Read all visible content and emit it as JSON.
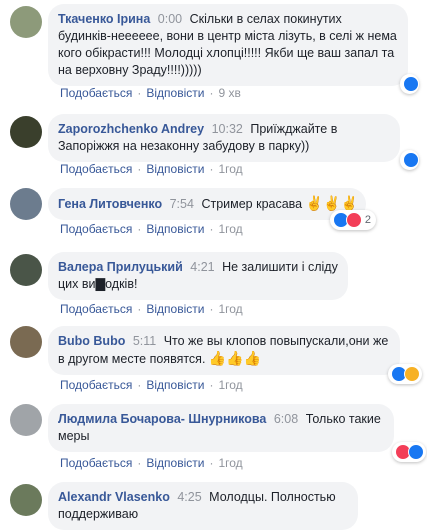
{
  "comments": [
    {
      "author": "Ткаченко Ірина",
      "time": "0:00",
      "text": "Скільки в селах покинутих будинків-нееееее, вони в центр міста лізуть, в селі ж нема кого обікрасти!!! Молодці хлопці!!!!! Якби ще ваш запал та на верховну Зраду!!!!)))))",
      "like": "Подобається",
      "reply": "Відповісти",
      "age": "9 хв",
      "reactions": [
        "like"
      ],
      "reaction_count": ""
    },
    {
      "author": "Zaporozhchenko Andrey",
      "time": "10:32",
      "text": "Приїжджайте в Запоріжжя на незаконну забудову в парку))",
      "like": "Подобається",
      "reply": "Відповісти",
      "age": "1год",
      "reactions": [
        "like"
      ],
      "reaction_count": ""
    },
    {
      "author": "Гена Литовченко",
      "time": "7:54",
      "text": "Стример красава",
      "emoji": "✌️✌️✌️",
      "like": "Подобається",
      "reply": "Відповісти",
      "age": "1год",
      "reactions": [
        "like",
        "love"
      ],
      "reaction_count": "2"
    },
    {
      "author": "Валера Прилуцький",
      "time": "4:21",
      "text": "Не залишити і сліду цих ви▇одків!",
      "like": "Подобається",
      "reply": "Відповісти",
      "age": "1год",
      "reactions": [],
      "reaction_count": ""
    },
    {
      "author": "Bubo Bubo",
      "time": "5:11",
      "text": "Что же вы клопов повыпускали,они же в другом месте появятся.",
      "emoji": "👍👍👍",
      "like": "Подобається",
      "reply": "Відповісти",
      "age": "1год",
      "reactions": [
        "like",
        "sad"
      ],
      "reaction_count": ""
    },
    {
      "author": "Людмила Бочарова- Шнурникова",
      "time": "6:08",
      "text": "Только такие меры",
      "like": "Подобається",
      "reply": "Відповісти",
      "age": "1год",
      "reactions": [
        "love",
        "like"
      ],
      "reaction_count": ""
    },
    {
      "author": "Alexandr Vlasenko",
      "time": "4:25",
      "text": "Молодцы. Полностью поддерживаю",
      "like": "",
      "reply": "",
      "age": "",
      "reactions": [],
      "reaction_count": ""
    }
  ],
  "colors": {
    "link": "#385898",
    "bubble": "#f2f3f5",
    "like": "#1877f2",
    "love": "#f33e58",
    "sad": "#f7b125"
  }
}
